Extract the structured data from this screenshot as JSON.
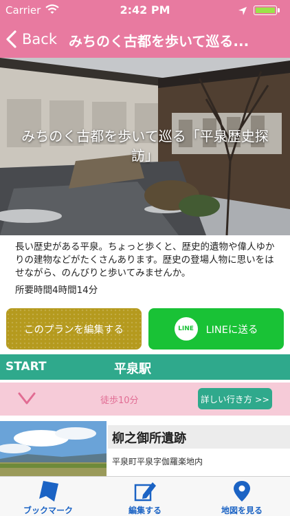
{
  "status_bar": {
    "carrier": "Carrier",
    "time": "2:42 PM"
  },
  "nav": {
    "back_label": "Back",
    "title": "みちのく古都を歩いて巡る..."
  },
  "hero": {
    "title": "みちのく古都を歩いて巡る「平泉歴史探訪」"
  },
  "description": "長い歴史がある平泉。ちょっと歩くと、歴史的遺物や偉人ゆかりの建物などがたくさんあります。歴史の登場人物に思いをはせながら、のんびりと歩いてみませんか。",
  "duration": "所要時間4時間14分",
  "actions": {
    "edit_label": "このプランを編集する",
    "line_logo": "LINE",
    "line_label": "LINEに送る"
  },
  "start": {
    "label": "START",
    "station": "平泉駅"
  },
  "walk": {
    "time": "徒歩10分",
    "route_button": "詳しい行き方 >>"
  },
  "spot": {
    "name": "柳之御所遺跡",
    "address": "平泉町平泉字伽羅楽地内"
  },
  "tabs": [
    {
      "label": "ブックマーク",
      "icon": "bookmark-icon"
    },
    {
      "label": "編集する",
      "icon": "edit-icon"
    },
    {
      "label": "地図を見る",
      "icon": "map-pin-icon"
    }
  ],
  "colors": {
    "header": "#e87aa0",
    "teal": "#2fa98c",
    "pink_light": "#f6cbd8",
    "line_green": "#19c236",
    "edit_gold": "#b59a1e",
    "tab_blue": "#1b63c4"
  }
}
